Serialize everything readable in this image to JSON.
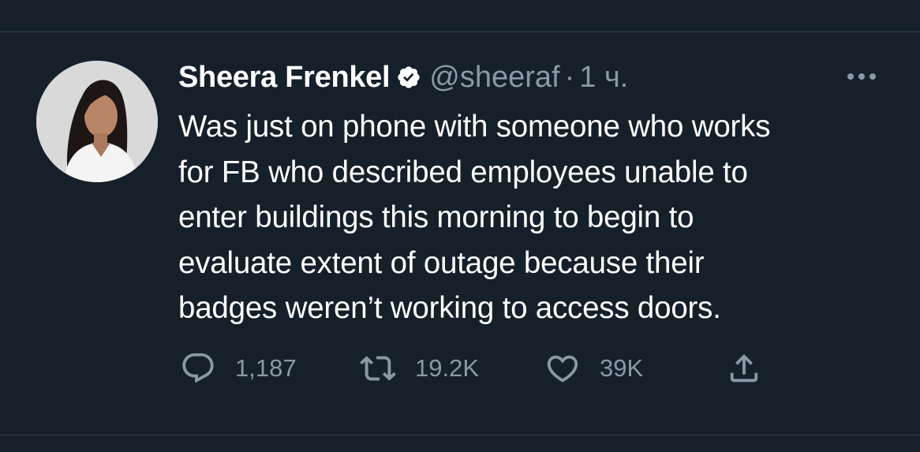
{
  "tweet": {
    "author_name": "Sheera Frenkel",
    "author_handle": "@sheeraf",
    "separator": "·",
    "time": "1 ч.",
    "text": "Was just on phone with someone who works\nfor FB who described employees unable to\nenter buildings this morning to begin to\nevaluate extent of outage because their\nbadges weren’t working to access doors."
  },
  "actions": {
    "replies": "1,187",
    "retweets": "19.2K",
    "likes": "39K"
  },
  "icons": {
    "verified": "verified-badge-icon",
    "more": "more-horizontal-icon",
    "reply": "reply-icon",
    "retweet": "retweet-icon",
    "like": "heart-icon",
    "share": "share-icon"
  },
  "colors": {
    "background": "#15202b",
    "text": "#ffffff",
    "secondary": "#8b98a5",
    "divider": "#38444d"
  }
}
